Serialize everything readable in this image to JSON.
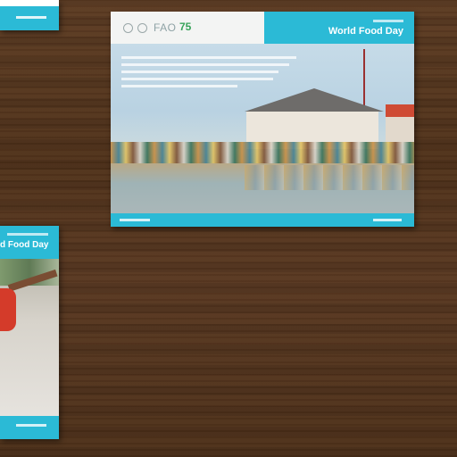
{
  "scene": {
    "wall_color": "#4f3220",
    "accent_color": "#2bbad6"
  },
  "poster_main": {
    "logo_text": "FAO",
    "anniversary_text": "75",
    "title": "World Food Day"
  },
  "poster_left": {
    "title": "d Food Day"
  }
}
